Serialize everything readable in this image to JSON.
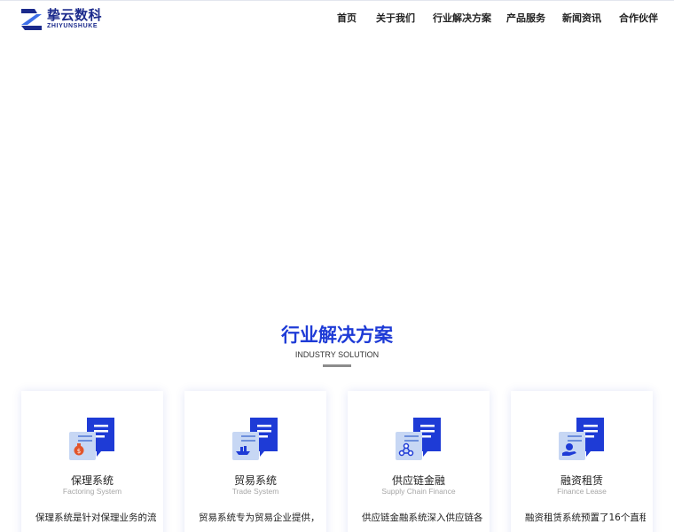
{
  "brand": {
    "name_cn": "挚云数科",
    "name_en": "ZHIYUNSHUKE",
    "logo_icon": "zs-logo-icon",
    "primary_color": "#1b2a8c"
  },
  "nav": {
    "items": [
      {
        "label": "首页"
      },
      {
        "label": "关于我们"
      },
      {
        "label": "行业解决方案"
      },
      {
        "label": "产品服务"
      },
      {
        "label": "新闻资讯"
      },
      {
        "label": "合作伙伴"
      }
    ]
  },
  "solutions": {
    "title": "行业解决方案",
    "subtitle": "INDUSTRY SOLUTION",
    "accent_color": "#1e3bd6",
    "cards": [
      {
        "title": "保理系统",
        "subtitle": "Factoring System",
        "desc": "保理系统是针对保理业务的流",
        "icon": "money-bag-document-icon"
      },
      {
        "title": "贸易系统",
        "subtitle": "Trade System",
        "desc": "贸易系统专为贸易企业提供，",
        "icon": "ship-document-icon"
      },
      {
        "title": "供应链金融",
        "subtitle": "Supply Chain Finance",
        "desc": "供应链金融系统深入供应链各",
        "icon": "chain-network-document-icon"
      },
      {
        "title": "融资租赁",
        "subtitle": "Finance Lease",
        "desc": "融资租赁系统预置了16个直租",
        "icon": "hand-coin-document-icon"
      }
    ]
  }
}
